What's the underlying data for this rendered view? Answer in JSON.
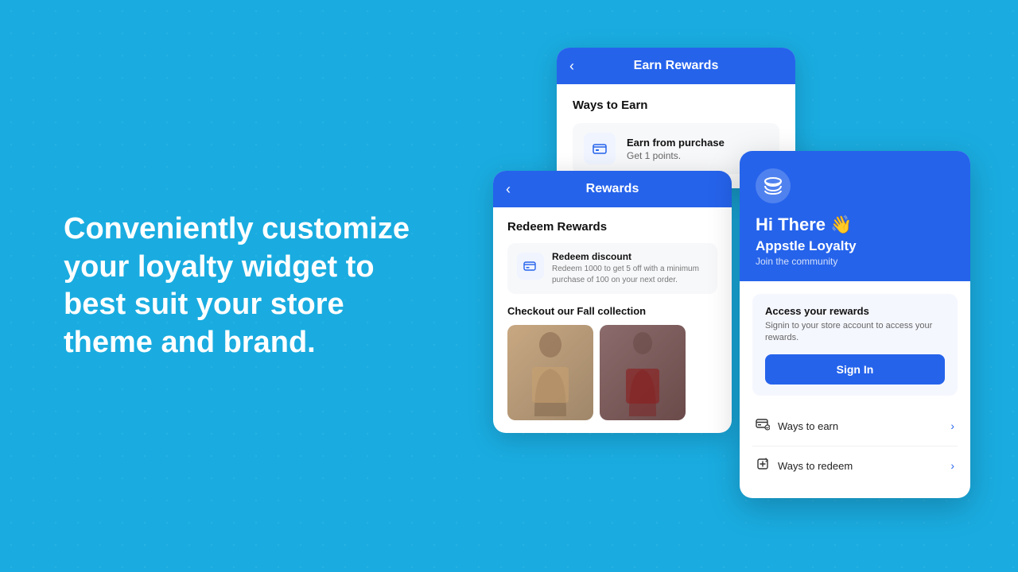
{
  "background": {
    "color": "#1AACE0"
  },
  "left_text": {
    "heading": "Conveniently customize your loyalty widget to best suit your store theme and brand."
  },
  "earn_rewards_card": {
    "header": {
      "back_label": "‹",
      "title": "Earn Rewards"
    },
    "body": {
      "ways_title": "Ways to Earn",
      "item": {
        "title": "Earn from purchase",
        "subtitle": "Get 1 points."
      }
    }
  },
  "rewards_card": {
    "header": {
      "back_label": "‹",
      "title": "Rewards"
    },
    "body": {
      "redeem_title": "Redeem Rewards",
      "redeem_item": {
        "name": "Redeem discount",
        "desc": "Redeem 1000 to get 5 off with a minimum purchase of 100 on your next order."
      },
      "collection_title": "Checkout our Fall collection"
    }
  },
  "widget_card": {
    "logo_icon": "🗄",
    "greeting": "Hi There 👋",
    "app_name": "Appstle Loyalty",
    "tagline": "Join the community",
    "access_box": {
      "title": "Access your rewards",
      "desc": "Signin to your store account to access your rewards.",
      "sign_in_label": "Sign In"
    },
    "nav_items": [
      {
        "icon": "🛒",
        "label": "Ways to earn"
      },
      {
        "icon": "↑",
        "label": "Ways to redeem"
      }
    ]
  }
}
